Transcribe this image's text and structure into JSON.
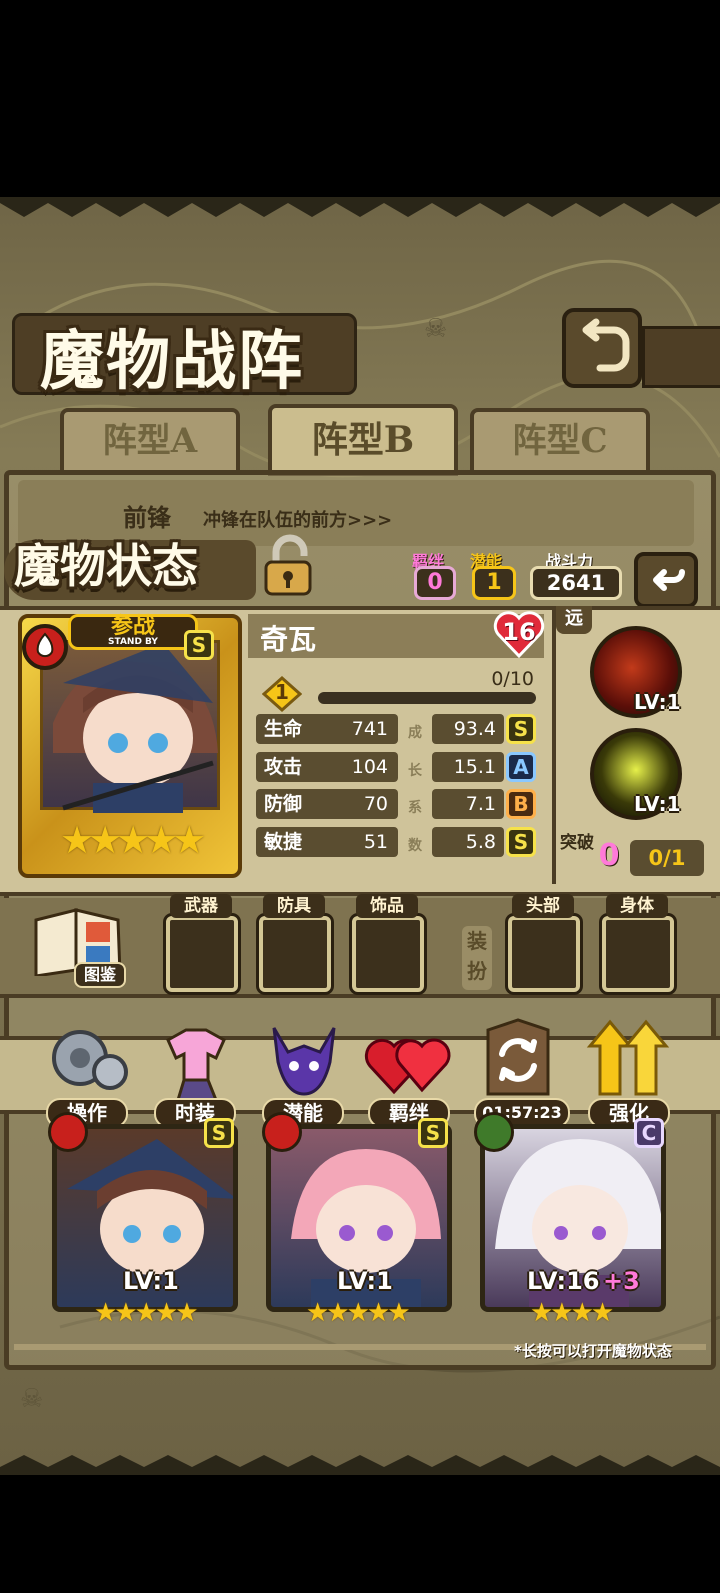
{
  "title": "魔物战阵",
  "formation_tabs": [
    {
      "label": "阵型A",
      "active": false
    },
    {
      "label": "阵型B",
      "active": true
    },
    {
      "label": "阵型C",
      "active": false
    }
  ],
  "vanguard": {
    "label": "前锋",
    "desc": "冲锋在队伍的前方>>>"
  },
  "status_title": "魔物状态",
  "summary": {
    "bond_label": "羁绊",
    "bond_value": "0",
    "potential_label": "潜能",
    "potential_value": "1",
    "power_label": "战斗力",
    "power_value": "2641"
  },
  "monster": {
    "badge": "参战",
    "badge_sub": "STAND BY",
    "rank": "S",
    "name": "奇瓦",
    "level_heart": "16",
    "stars": "★★★★★",
    "exp_level": "1",
    "exp": "0/10",
    "exp_fraction": 0.0,
    "stats": [
      {
        "label": "生命",
        "value": "741",
        "growth": "93.4",
        "grade": "S"
      },
      {
        "label": "攻击",
        "value": "104",
        "growth": "15.1",
        "grade": "A"
      },
      {
        "label": "防御",
        "value": "70",
        "growth": "7.1",
        "grade": "B"
      },
      {
        "label": "敏捷",
        "value": "51",
        "growth": "5.8",
        "grade": "S"
      }
    ],
    "growth_chars": [
      "成",
      "长",
      "系",
      "数"
    ]
  },
  "skills": {
    "range": "远",
    "items": [
      {
        "level": "LV:1",
        "icon": "fire-orb-icon"
      },
      {
        "level": "LV:1",
        "icon": "lightning-orb-icon"
      }
    ],
    "breakthrough_label": "突破",
    "breakthrough_value": "0",
    "breakthrough_progress": "0/1"
  },
  "equipment": {
    "codex_label": "图鉴",
    "slots_left": [
      "武器",
      "防具",
      "饰品"
    ],
    "outfit_label": "装扮",
    "slots_right": [
      "头部",
      "身体"
    ]
  },
  "actions": [
    {
      "label": "操作",
      "icon": "gear-icon"
    },
    {
      "label": "时装",
      "icon": "outfit-icon"
    },
    {
      "label": "潜能",
      "icon": "demon-icon"
    },
    {
      "label": "羁绊",
      "icon": "hearts-icon"
    },
    {
      "label": "01:57:23",
      "icon": "refresh-icon"
    },
    {
      "label": "强化",
      "icon": "upgrade-arrows-icon"
    }
  ],
  "roster": [
    {
      "rank": "S",
      "level": "LV:1",
      "bonus": "",
      "stars": "★★★★★",
      "element": "fire"
    },
    {
      "rank": "S",
      "level": "LV:1",
      "bonus": "",
      "stars": "★★★★★",
      "element": "fire"
    },
    {
      "rank": "C",
      "level": "LV:16",
      "bonus": "+3",
      "stars": "★★★★",
      "element": "nature"
    }
  ],
  "hint": "*长按可以打开魔物状态",
  "colors": {
    "gold": "#f6c518",
    "fire": "#c8201c",
    "nature": "#3f7a2a",
    "pink": "#ff7ad9"
  }
}
